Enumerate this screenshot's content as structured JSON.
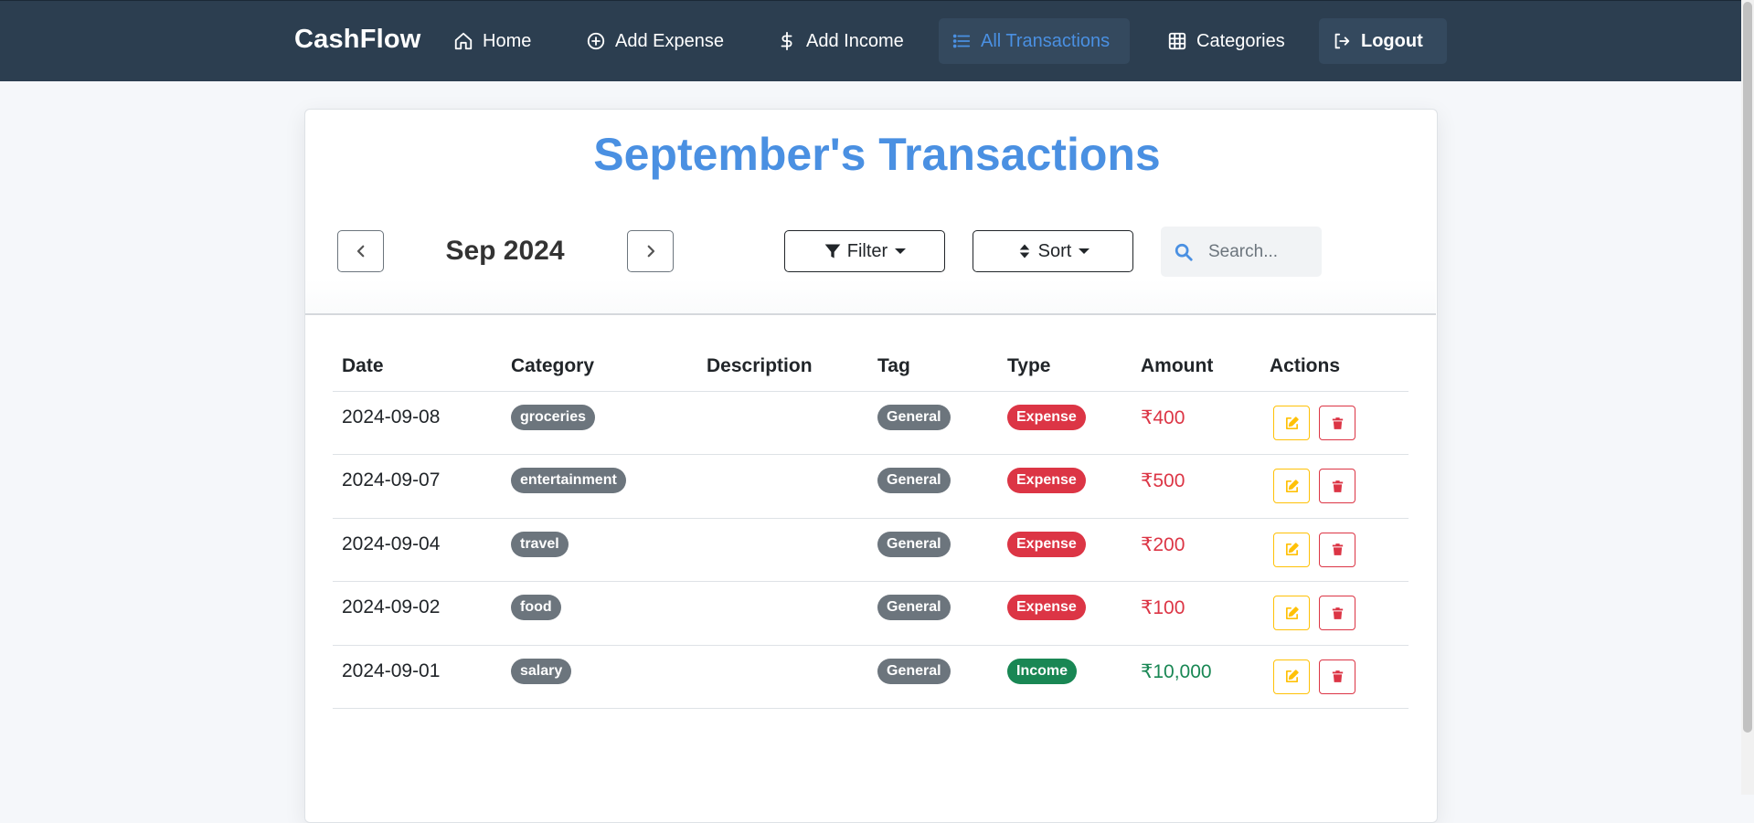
{
  "nav": {
    "brand": "CashFlow",
    "items": [
      {
        "label": "Home",
        "icon": "house-icon"
      },
      {
        "label": "Add Expense",
        "icon": "plus-circle-icon"
      },
      {
        "label": "Add Income",
        "icon": "dollar-icon"
      },
      {
        "label": "All Transactions",
        "icon": "list-icon",
        "active": true
      },
      {
        "label": "Categories",
        "icon": "grid-icon"
      },
      {
        "label": "Logout",
        "icon": "logout-icon"
      }
    ]
  },
  "page": {
    "title": "September's Transactions",
    "month_label": "Sep 2024",
    "filter_label": "Filter",
    "sort_label": "Sort",
    "search_placeholder": "Search..."
  },
  "table": {
    "headers": [
      "Date",
      "Category",
      "Description",
      "Tag",
      "Type",
      "Amount",
      "Actions"
    ],
    "rows": [
      {
        "date": "2024-09-08",
        "category": "groceries",
        "description": "",
        "tag": "General",
        "type": "Expense",
        "amount": "₹400"
      },
      {
        "date": "2024-09-07",
        "category": "entertainment",
        "description": "",
        "tag": "General",
        "type": "Expense",
        "amount": "₹500"
      },
      {
        "date": "2024-09-04",
        "category": "travel",
        "description": "",
        "tag": "General",
        "type": "Expense",
        "amount": "₹200"
      },
      {
        "date": "2024-09-02",
        "category": "food",
        "description": "",
        "tag": "General",
        "type": "Expense",
        "amount": "₹100"
      },
      {
        "date": "2024-09-01",
        "category": "salary",
        "description": "",
        "tag": "General",
        "type": "Income",
        "amount": "₹10,000"
      }
    ]
  },
  "colors": {
    "navbar": "#2c3e50",
    "accent": "#4a90e2",
    "expense": "#dc3545",
    "income": "#198754",
    "badge_gray": "#6c757d",
    "edit": "#ffc107"
  }
}
